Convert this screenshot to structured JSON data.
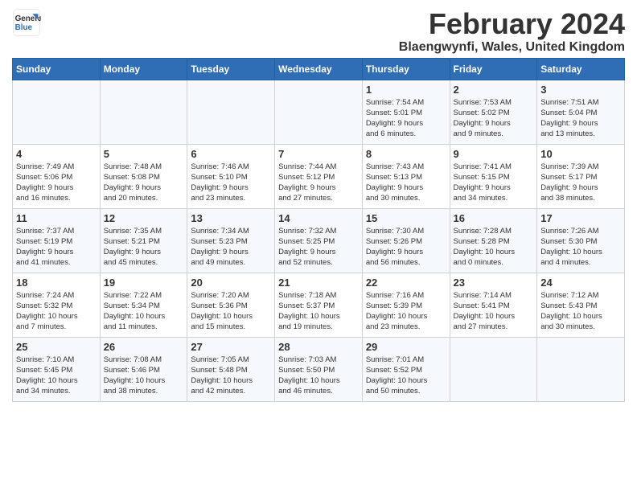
{
  "logo": {
    "line1": "General",
    "line2": "Blue"
  },
  "title": "February 2024",
  "location": "Blaengwynfi, Wales, United Kingdom",
  "headers": [
    "Sunday",
    "Monday",
    "Tuesday",
    "Wednesday",
    "Thursday",
    "Friday",
    "Saturday"
  ],
  "weeks": [
    [
      {
        "day": "",
        "info": ""
      },
      {
        "day": "",
        "info": ""
      },
      {
        "day": "",
        "info": ""
      },
      {
        "day": "",
        "info": ""
      },
      {
        "day": "1",
        "info": "Sunrise: 7:54 AM\nSunset: 5:01 PM\nDaylight: 9 hours\nand 6 minutes."
      },
      {
        "day": "2",
        "info": "Sunrise: 7:53 AM\nSunset: 5:02 PM\nDaylight: 9 hours\nand 9 minutes."
      },
      {
        "day": "3",
        "info": "Sunrise: 7:51 AM\nSunset: 5:04 PM\nDaylight: 9 hours\nand 13 minutes."
      }
    ],
    [
      {
        "day": "4",
        "info": "Sunrise: 7:49 AM\nSunset: 5:06 PM\nDaylight: 9 hours\nand 16 minutes."
      },
      {
        "day": "5",
        "info": "Sunrise: 7:48 AM\nSunset: 5:08 PM\nDaylight: 9 hours\nand 20 minutes."
      },
      {
        "day": "6",
        "info": "Sunrise: 7:46 AM\nSunset: 5:10 PM\nDaylight: 9 hours\nand 23 minutes."
      },
      {
        "day": "7",
        "info": "Sunrise: 7:44 AM\nSunset: 5:12 PM\nDaylight: 9 hours\nand 27 minutes."
      },
      {
        "day": "8",
        "info": "Sunrise: 7:43 AM\nSunset: 5:13 PM\nDaylight: 9 hours\nand 30 minutes."
      },
      {
        "day": "9",
        "info": "Sunrise: 7:41 AM\nSunset: 5:15 PM\nDaylight: 9 hours\nand 34 minutes."
      },
      {
        "day": "10",
        "info": "Sunrise: 7:39 AM\nSunset: 5:17 PM\nDaylight: 9 hours\nand 38 minutes."
      }
    ],
    [
      {
        "day": "11",
        "info": "Sunrise: 7:37 AM\nSunset: 5:19 PM\nDaylight: 9 hours\nand 41 minutes."
      },
      {
        "day": "12",
        "info": "Sunrise: 7:35 AM\nSunset: 5:21 PM\nDaylight: 9 hours\nand 45 minutes."
      },
      {
        "day": "13",
        "info": "Sunrise: 7:34 AM\nSunset: 5:23 PM\nDaylight: 9 hours\nand 49 minutes."
      },
      {
        "day": "14",
        "info": "Sunrise: 7:32 AM\nSunset: 5:25 PM\nDaylight: 9 hours\nand 52 minutes."
      },
      {
        "day": "15",
        "info": "Sunrise: 7:30 AM\nSunset: 5:26 PM\nDaylight: 9 hours\nand 56 minutes."
      },
      {
        "day": "16",
        "info": "Sunrise: 7:28 AM\nSunset: 5:28 PM\nDaylight: 10 hours\nand 0 minutes."
      },
      {
        "day": "17",
        "info": "Sunrise: 7:26 AM\nSunset: 5:30 PM\nDaylight: 10 hours\nand 4 minutes."
      }
    ],
    [
      {
        "day": "18",
        "info": "Sunrise: 7:24 AM\nSunset: 5:32 PM\nDaylight: 10 hours\nand 7 minutes."
      },
      {
        "day": "19",
        "info": "Sunrise: 7:22 AM\nSunset: 5:34 PM\nDaylight: 10 hours\nand 11 minutes."
      },
      {
        "day": "20",
        "info": "Sunrise: 7:20 AM\nSunset: 5:36 PM\nDaylight: 10 hours\nand 15 minutes."
      },
      {
        "day": "21",
        "info": "Sunrise: 7:18 AM\nSunset: 5:37 PM\nDaylight: 10 hours\nand 19 minutes."
      },
      {
        "day": "22",
        "info": "Sunrise: 7:16 AM\nSunset: 5:39 PM\nDaylight: 10 hours\nand 23 minutes."
      },
      {
        "day": "23",
        "info": "Sunrise: 7:14 AM\nSunset: 5:41 PM\nDaylight: 10 hours\nand 27 minutes."
      },
      {
        "day": "24",
        "info": "Sunrise: 7:12 AM\nSunset: 5:43 PM\nDaylight: 10 hours\nand 30 minutes."
      }
    ],
    [
      {
        "day": "25",
        "info": "Sunrise: 7:10 AM\nSunset: 5:45 PM\nDaylight: 10 hours\nand 34 minutes."
      },
      {
        "day": "26",
        "info": "Sunrise: 7:08 AM\nSunset: 5:46 PM\nDaylight: 10 hours\nand 38 minutes."
      },
      {
        "day": "27",
        "info": "Sunrise: 7:05 AM\nSunset: 5:48 PM\nDaylight: 10 hours\nand 42 minutes."
      },
      {
        "day": "28",
        "info": "Sunrise: 7:03 AM\nSunset: 5:50 PM\nDaylight: 10 hours\nand 46 minutes."
      },
      {
        "day": "29",
        "info": "Sunrise: 7:01 AM\nSunset: 5:52 PM\nDaylight: 10 hours\nand 50 minutes."
      },
      {
        "day": "",
        "info": ""
      },
      {
        "day": "",
        "info": ""
      }
    ]
  ]
}
